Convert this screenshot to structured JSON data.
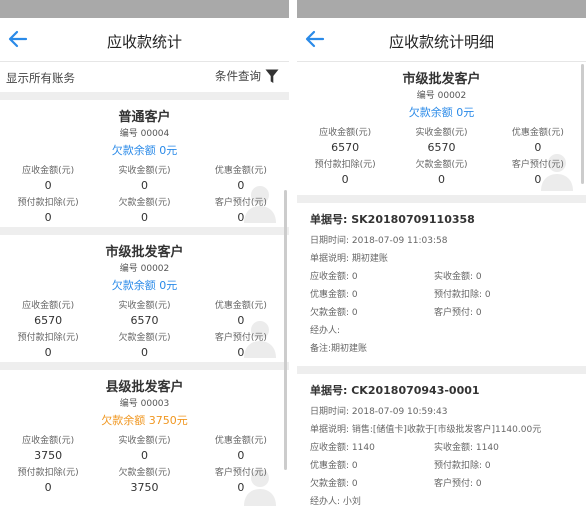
{
  "left": {
    "title": "应收款统计",
    "show_all": "显示所有账务",
    "filter_label": "条件查询",
    "customers": [
      {
        "name": "普通客户",
        "code": "编号 00004",
        "owe": "欠款余额 0元",
        "owe_color": "#2a8ae8",
        "labels": [
          "应收金额(元)",
          "实收金额(元)",
          "优惠金额(元)",
          "预付款扣除(元)",
          "欠款金额(元)",
          "客户预付(元)"
        ],
        "values": [
          "0",
          "0",
          "0",
          "0",
          "0",
          "0"
        ]
      },
      {
        "name": "市级批发客户",
        "code": "编号 00002",
        "owe": "欠款余额 0元",
        "owe_color": "#2a8ae8",
        "labels": [
          "应收金额(元)",
          "实收金额(元)",
          "优惠金额(元)",
          "预付款扣除(元)",
          "欠款金额(元)",
          "客户预付(元)"
        ],
        "values": [
          "6570",
          "6570",
          "0",
          "0",
          "0",
          "0"
        ]
      },
      {
        "name": "县级批发客户",
        "code": "编号 00003",
        "owe": "欠款余额 3750元",
        "owe_color": "#f0961f",
        "labels": [
          "应收金额(元)",
          "实收金额(元)",
          "优惠金额(元)",
          "预付款扣除(元)",
          "欠款金额(元)",
          "客户预付(元)"
        ],
        "values": [
          "3750",
          "0",
          "0",
          "0",
          "3750",
          "0"
        ]
      }
    ]
  },
  "right": {
    "title": "应收款统计明细",
    "customer": {
      "name": "市级批发客户",
      "code": "编号 00002",
      "owe": "欠款余额 0元",
      "labels": [
        "应收金额(元)",
        "实收金额(元)",
        "优惠金额(元)",
        "预付款扣除(元)",
        "欠款金额(元)",
        "客户预付(元)"
      ],
      "values": [
        "6570",
        "6570",
        "0",
        "0",
        "0",
        "0"
      ]
    },
    "records": [
      {
        "docno": "单据号: SK20180709110358",
        "date": "日期时间: 2018-07-09 11:03:58",
        "desc": "单据说明: 期初建账",
        "receivable": "应收金额: 0",
        "received": "实收金额: 0",
        "discount": "优惠金额: 0",
        "prepay_deduct": "预付款扣除: 0",
        "owed": "欠款金额: 0",
        "prepay": "客户预付: 0",
        "handler": "经办人:",
        "note": "备注:期初建账"
      },
      {
        "docno": "单据号: CK2018070943-0001",
        "date": "日期时间: 2018-07-09 10:59:43",
        "desc": "单据说明: 销售:[储值卡]收款于[市级批发客户]1140.00元",
        "receivable": "应收金额: 1140",
        "received": "实收金额: 1140",
        "discount": "优惠金额: 0",
        "prepay_deduct": "预付款扣除: 0",
        "owed": "欠款金额: 0",
        "prepay": "客户预付: 0",
        "handler": "经办人: 小刘"
      }
    ]
  },
  "icons": {
    "back": "back-arrow-icon",
    "filter": "funnel-icon",
    "avatar": "person-silhouette-icon"
  },
  "colors": {
    "accent_blue": "#2a8ae8",
    "owe_orange": "#f0961f",
    "status_bar": "#a9a9a9",
    "divider": "#eeeeee"
  }
}
